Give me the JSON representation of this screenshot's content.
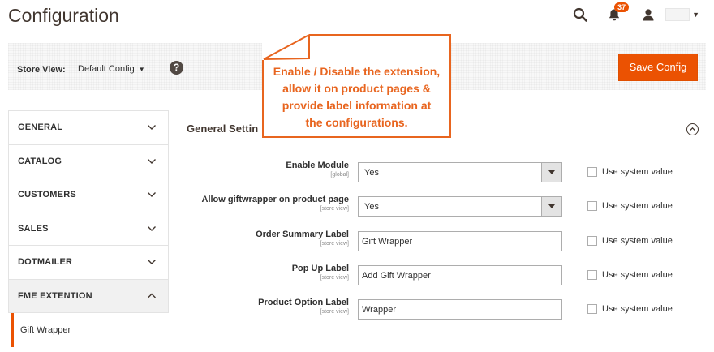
{
  "page": {
    "title": "Configuration"
  },
  "header": {
    "notifications_count": "37",
    "icons": [
      "search-icon",
      "bell-icon",
      "user-icon",
      "chevron-down-icon"
    ]
  },
  "store_bar": {
    "label": "Store View:",
    "selected": "Default Config",
    "help_icon": "?"
  },
  "toolbar": {
    "save_label": "Save Config"
  },
  "callout": {
    "lines": [
      "Enable / Disable the extension,",
      "allow it on product pages &",
      "provide label information at",
      "the configurations."
    ]
  },
  "sidebar": {
    "items": [
      {
        "label": "GENERAL",
        "expanded": false
      },
      {
        "label": "CATALOG",
        "expanded": false
      },
      {
        "label": "CUSTOMERS",
        "expanded": false
      },
      {
        "label": "SALES",
        "expanded": false
      },
      {
        "label": "DOTMAILER",
        "expanded": false
      },
      {
        "label": "FME EXTENTION",
        "expanded": true
      }
    ],
    "sub_items": [
      {
        "label": "Gift Wrapper"
      }
    ]
  },
  "section": {
    "title": "General Settings",
    "visible_title": "General Settin",
    "fields": [
      {
        "label": "Enable Module",
        "scope": "[global]",
        "type": "select",
        "value": "Yes",
        "system_label": "Use system value",
        "system_checked": false
      },
      {
        "label": "Allow giftwrapper on product page",
        "scope": "[store view]",
        "type": "select",
        "value": "Yes",
        "system_label": "Use system value",
        "system_checked": false
      },
      {
        "label": "Order Summary Label",
        "scope": "[store view]",
        "type": "text",
        "value": "Gift Wrapper",
        "system_label": "Use system value",
        "system_checked": false
      },
      {
        "label": "Pop Up Label",
        "scope": "[store view]",
        "type": "text",
        "value": "Add Gift Wrapper",
        "system_label": "Use system value",
        "system_checked": false
      },
      {
        "label": "Product Option Label",
        "scope": "[store view]",
        "type": "text",
        "value": "Wrapper",
        "system_label": "Use system value",
        "system_checked": false
      }
    ]
  },
  "colors": {
    "accent": "#eb5202",
    "callout": "#e8651f",
    "text": "#303030",
    "title": "#41362f"
  }
}
